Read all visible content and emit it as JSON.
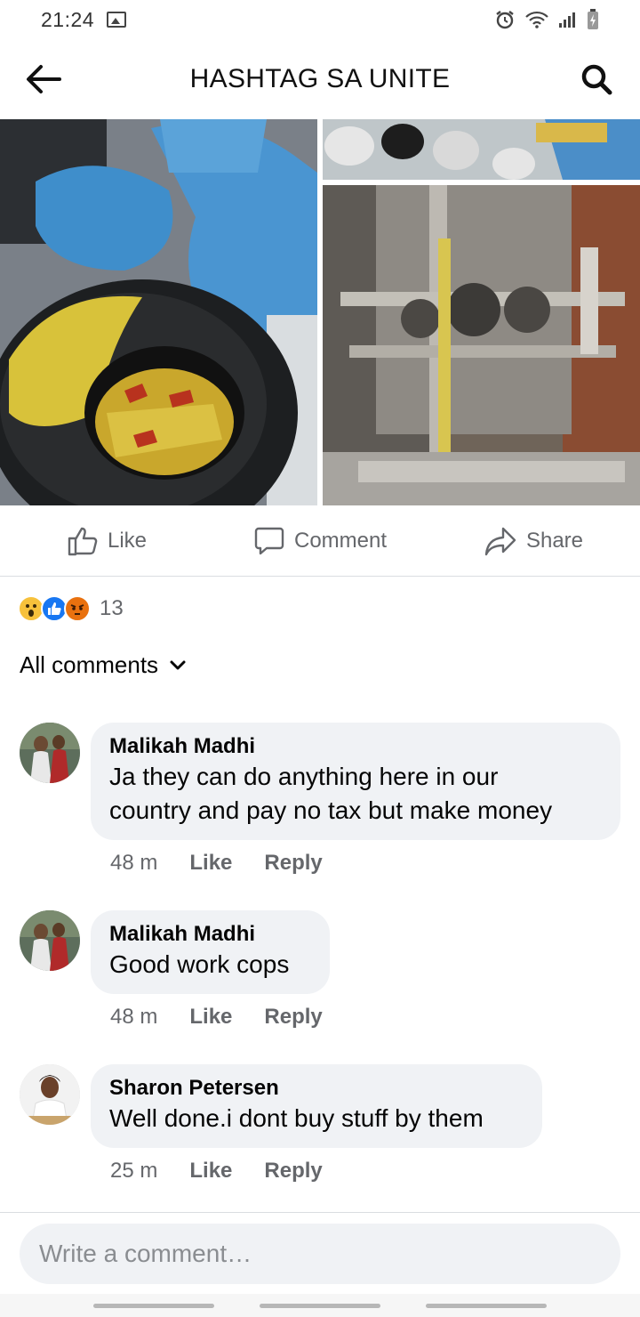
{
  "status_bar": {
    "time": "21:24",
    "icons": [
      "image-icon",
      "alarm-icon",
      "wifi-icon",
      "signal-icon",
      "battery-icon"
    ]
  },
  "header": {
    "title": "HASHTAG SA UNITE",
    "back_icon": "arrow-left-icon",
    "search_icon": "search-icon"
  },
  "photos": [
    {
      "subject": "seized snack packets in buckets"
    },
    {
      "subject": "drink cans"
    },
    {
      "subject": "packaging machine"
    }
  ],
  "actions": {
    "like": "Like",
    "comment": "Comment",
    "share": "Share"
  },
  "reactions": {
    "types": [
      "wow",
      "like",
      "angry"
    ],
    "count": "13"
  },
  "comments_filter": {
    "label": "All comments"
  },
  "comments": [
    {
      "author": "Malikah Madhi",
      "text_line1": "Ja they can do anything here in our",
      "text_line2": "country and pay no tax but make money",
      "time": "48 m",
      "like": "Like",
      "reply": "Reply"
    },
    {
      "author": "Malikah Madhi",
      "text": "Good work cops",
      "time": "48 m",
      "like": "Like",
      "reply": "Reply"
    },
    {
      "author": "Sharon Petersen",
      "text": "Well done.i dont buy stuff by them",
      "time": "25 m",
      "like": "Like",
      "reply": "Reply"
    }
  ],
  "compose": {
    "placeholder": "Write a comment…"
  },
  "colors": {
    "text_primary": "#050505",
    "text_secondary": "#65676b",
    "bubble_bg": "#f0f2f5",
    "like_blue": "#1877f2",
    "wow_yellow": "#f7c13b",
    "angry_orange": "#e9710f"
  }
}
